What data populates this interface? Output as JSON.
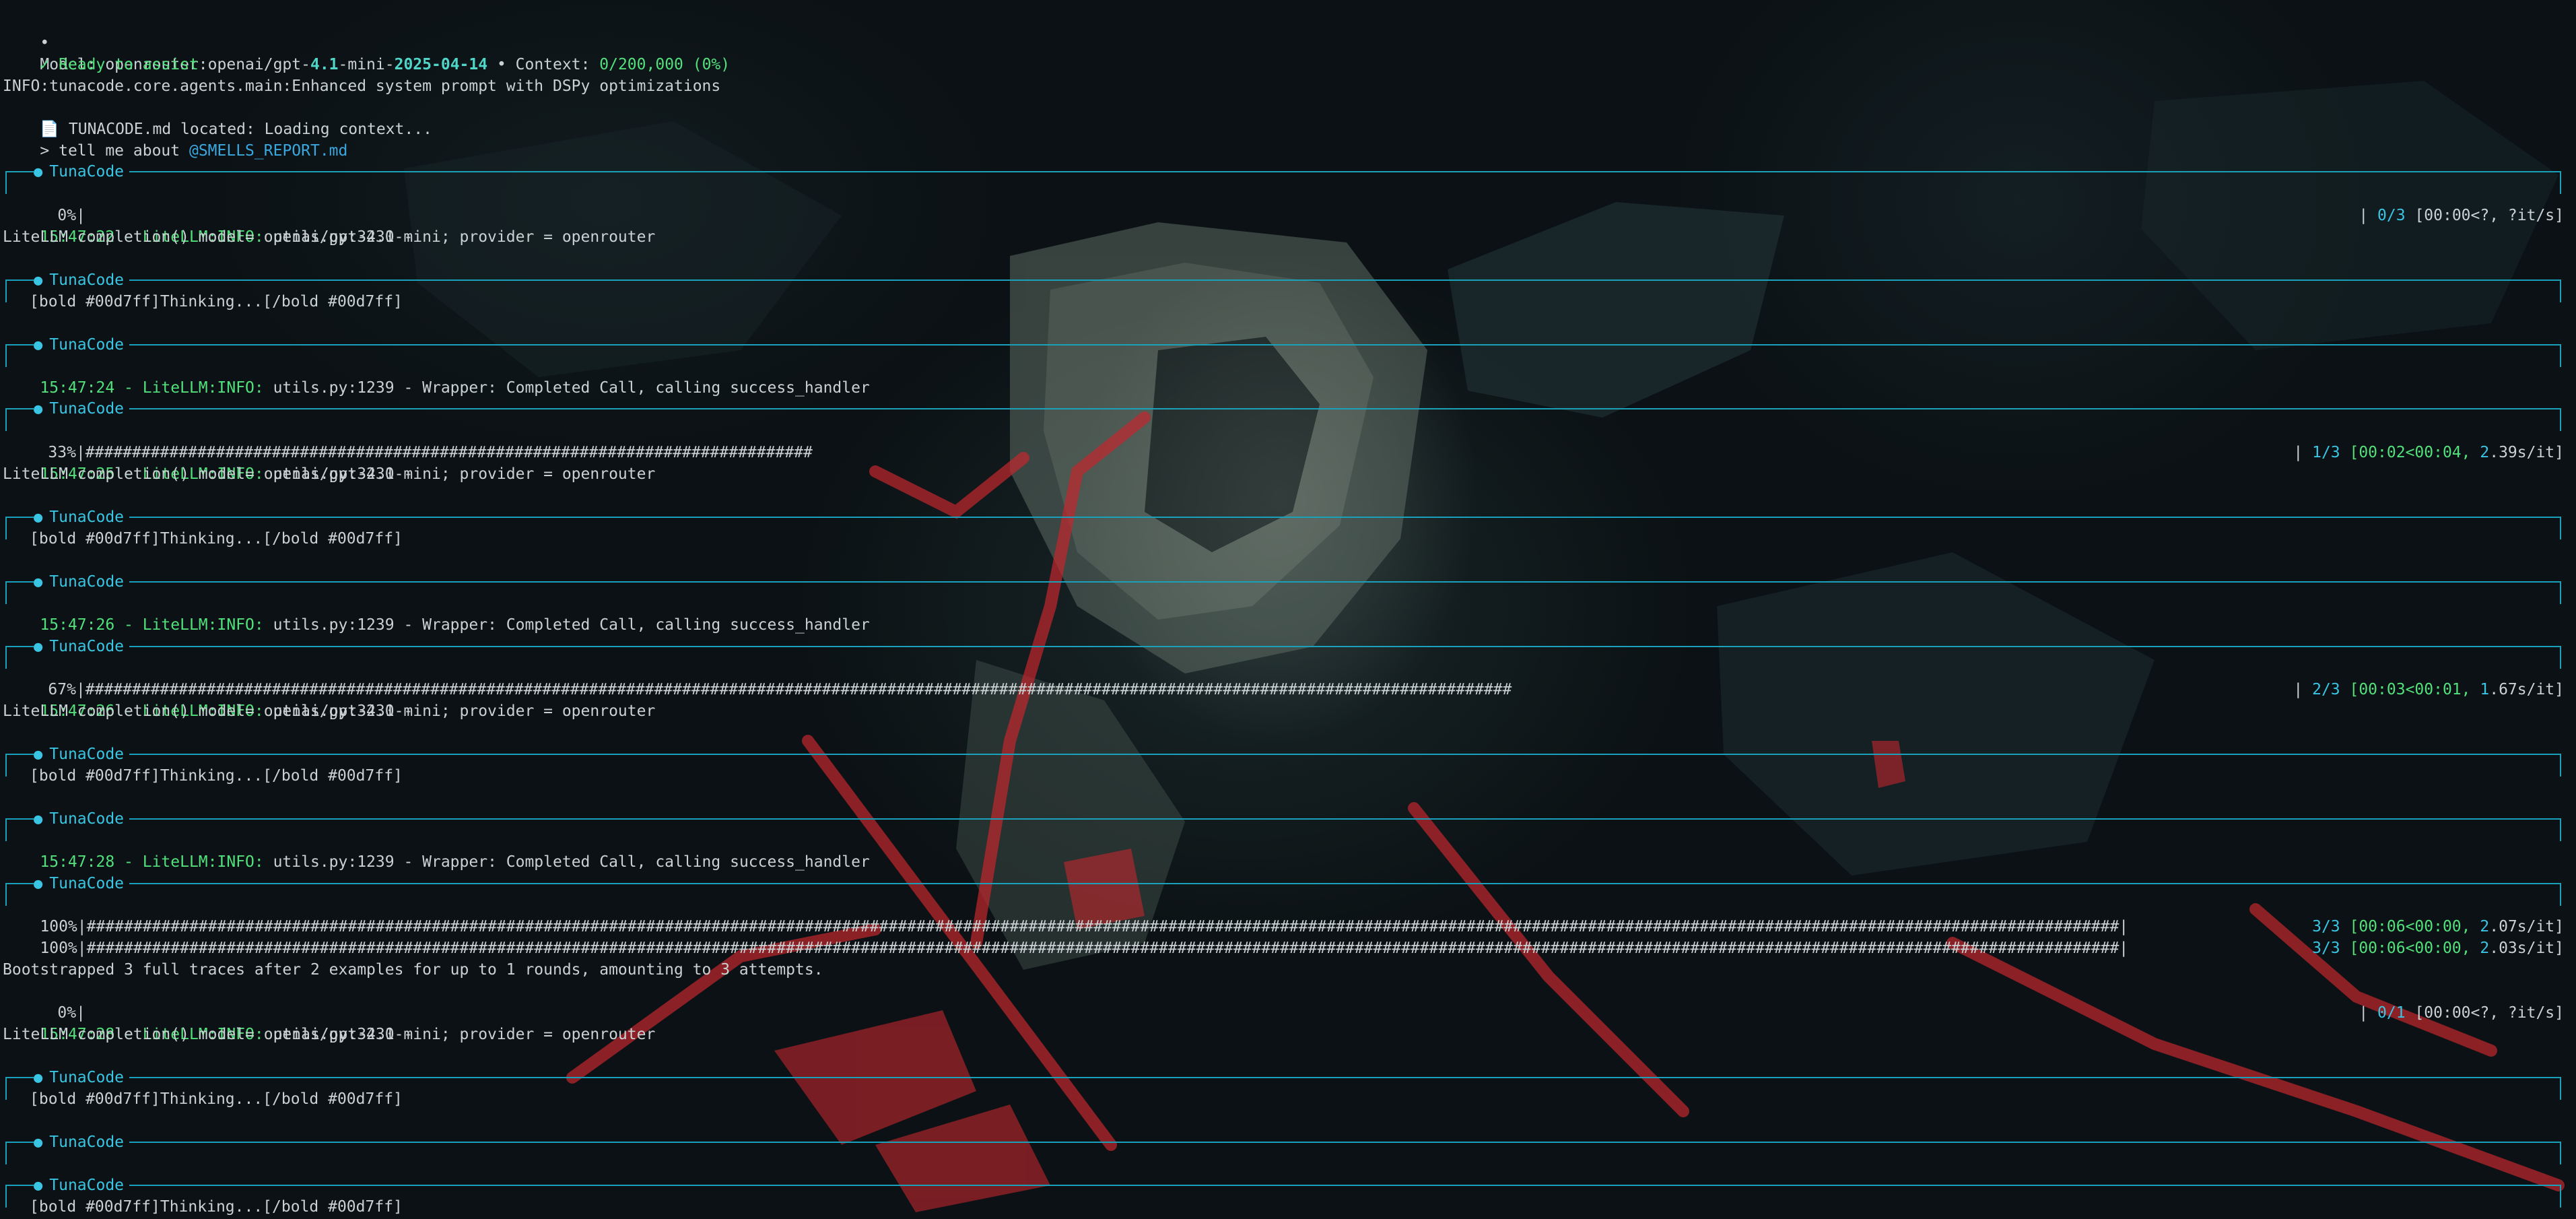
{
  "header": {
    "model_bullet": "•",
    "model_label": "Model: ",
    "model_prefix": "openrouter:openai/gpt-",
    "model_version": "4.1",
    "model_mid": "-mini-",
    "model_date": "2025-04-14",
    "context_sep": " • Context: ",
    "context_value": "0/200,000 (0%)",
    "ready_mark": "✓",
    "ready_text": " Ready to assist",
    "info_line": "INFO:tunacode.core.agents.main:Enhanced system prompt with DSPy optimizations",
    "doc_icon": "📄",
    "tunacode_located": " TUNACODE.md located: Loading context...",
    "prompt_symbol": ">",
    "prompt_text": " tell me about ",
    "prompt_ref": "@SMELLS_REPORT.md"
  },
  "panel": {
    "title": "TunaCode",
    "dot": "●"
  },
  "thinking_text": "[bold #00d7ff]Thinking...[/bold #00d7ff]",
  "progress": [
    {
      "percent": "0%",
      "bar": "|",
      "right_pipe": "| ",
      "count": "0/3",
      "timing": " [00:00<?, ?it/s]"
    },
    {
      "percent": "33%",
      "bar": "|##############################################################################",
      "right_pipe": "| ",
      "count": "1/3",
      "timing_a": " [00:02<00:04, ",
      "rate_num": "2",
      "rate_rest": ".39s/it]"
    },
    {
      "percent": "67%",
      "bar": "|#########################################################################################################################################################",
      "right_pipe": "| ",
      "count": "2/3",
      "timing_a": " [00:03<00:01, ",
      "rate_num": "1",
      "rate_rest": ".67s/it]"
    },
    {
      "percent": "100%",
      "bar": "|##########################################################################################################################################################################################################################|",
      "right_pipe": " ",
      "count": "3/3",
      "timing_a": " [00:06<00:00, ",
      "rate_num": "2",
      "rate_rest": ".07s/it]"
    },
    {
      "percent": "100%",
      "bar": "|##########################################################################################################################################################################################################################|",
      "right_pipe": " ",
      "count": "3/3",
      "timing_a": " [00:06<00:00, ",
      "rate_num": "2",
      "rate_rest": ".03s/it]"
    },
    {
      "percent": "0%",
      "bar": "|",
      "right_pipe": "| ",
      "count": "0/1",
      "timing": " [00:00<?, ?it/s]"
    }
  ],
  "logs": {
    "t1": "15:47:22 - LiteLLM:INFO:",
    "t1_rest": " utils.py:3230 -",
    "completion": "LiteLLM completion() model= openai/gpt-4.1-mini; provider = openrouter",
    "t2": "15:47:24 - LiteLLM:INFO:",
    "t2_rest": " utils.py:1239 - Wrapper: Completed Call, calling success_handler",
    "t3": "15:47:25 - LiteLLM:INFO:",
    "t3_rest": " utils.py:3230 -",
    "t4": "15:47:26 - LiteLLM:INFO:",
    "t4_rest": " utils.py:1239 - Wrapper: Completed Call, calling success_handler",
    "t5": "15:47:26 - LiteLLM:INFO:",
    "t5_rest": " utils.py:3230 -",
    "t6": "15:47:28 - LiteLLM:INFO:",
    "t6_rest": " utils.py:1239 - Wrapper: Completed Call, calling success_handler",
    "bootstrapped": "Bootstrapped 3 full traces after 2 examples for up to 1 rounds, amounting to 3 attempts.",
    "t7": "15:47:28 - LiteLLM:INFO:",
    "t7_rest": " utils.py:3230 -"
  },
  "colors": {
    "panel_border": "#1aa0b8",
    "accent_cyan": "#39c5e3",
    "timestamp_green": "#52e07c",
    "text": "#c9d1d3",
    "wallpaper_red": "#c2272d"
  }
}
